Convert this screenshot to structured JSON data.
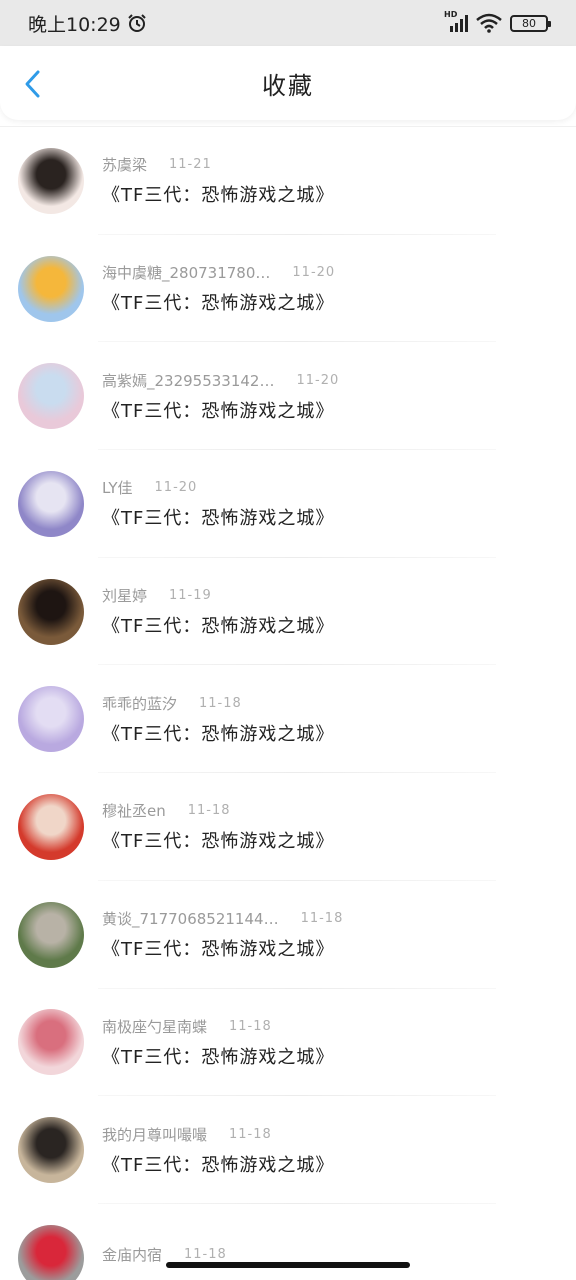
{
  "status_bar": {
    "time": "晚上10:29",
    "battery": "80"
  },
  "nav": {
    "title": "收藏"
  },
  "favorites": [
    {
      "username": "苏虞梁",
      "time": "11-21",
      "title": "《TF三代：恐怖游戏之城》",
      "avatar_colors": [
        "#f3e8e4",
        "#2a2320"
      ]
    },
    {
      "username": "海中虞糖_280731780…",
      "time": "11-20",
      "title": "《TF三代：恐怖游戏之城》",
      "avatar_colors": [
        "#9fc6ec",
        "#f5b73b"
      ]
    },
    {
      "username": "高紫嫣_23295533142…",
      "time": "11-20",
      "title": "《TF三代：恐怖游戏之城》",
      "avatar_colors": [
        "#e9c9d9",
        "#c9dcef"
      ]
    },
    {
      "username": "LY佳",
      "time": "11-20",
      "title": "《TF三代：恐怖游戏之城》",
      "avatar_colors": [
        "#8f87c8",
        "#e6e4f2"
      ]
    },
    {
      "username": "刘星婷",
      "time": "11-19",
      "title": "《TF三代：恐怖游戏之城》",
      "avatar_colors": [
        "#7a5a3a",
        "#1e1512"
      ]
    },
    {
      "username": "乖乖的蓝汐",
      "time": "11-18",
      "title": "《TF三代：恐怖游戏之城》",
      "avatar_colors": [
        "#b9a9e0",
        "#e3ddf3"
      ]
    },
    {
      "username": "穆祉丞en",
      "time": "11-18",
      "title": "《TF三代：恐怖游戏之城》",
      "avatar_colors": [
        "#d43a2c",
        "#f0d6c8"
      ]
    },
    {
      "username": "黄谈_7177068521144…",
      "time": "11-18",
      "title": "《TF三代：恐怖游戏之城》",
      "avatar_colors": [
        "#5f7a4a",
        "#b8b2a6"
      ]
    },
    {
      "username": "南极座勺星南蝶",
      "time": "11-18",
      "title": "《TF三代：恐怖游戏之城》",
      "avatar_colors": [
        "#f2d6da",
        "#d96f7e"
      ]
    },
    {
      "username": "我的月尊叫嘬嘬",
      "time": "11-18",
      "title": "《TF三代：恐怖游戏之城》",
      "avatar_colors": [
        "#c7b59b",
        "#2a2522"
      ]
    },
    {
      "username": "金庙内宿",
      "time": "11-18",
      "title": "",
      "avatar_colors": [
        "#9c9c9c",
        "#d9273a"
      ]
    }
  ]
}
